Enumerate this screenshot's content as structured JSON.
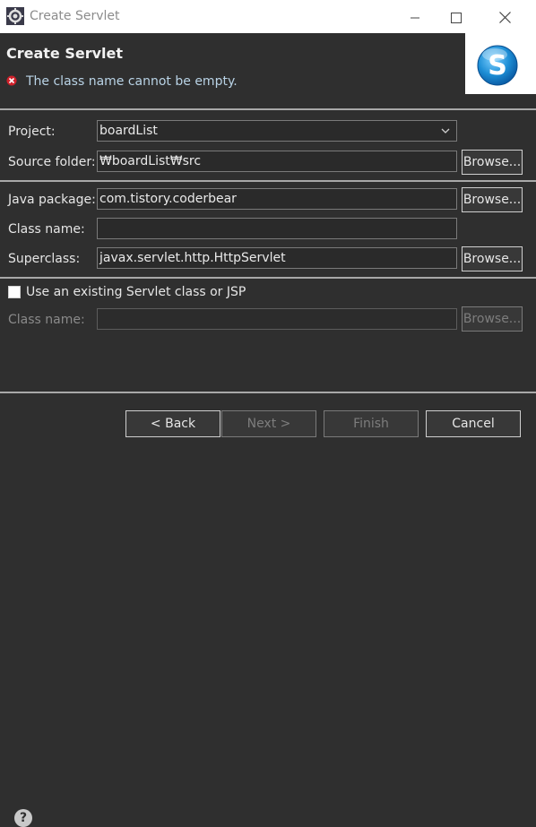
{
  "window": {
    "title": "Create Servlet",
    "app_icon": "eclipse-icon",
    "minimize_icon": "minimize-icon",
    "maximize_icon": "maximize-icon",
    "close_icon": "close-icon"
  },
  "header": {
    "title": "Create Servlet",
    "error_message": "The class name cannot be empty.",
    "error_icon": "error-icon",
    "banner_icon": "servlet-wizard-icon",
    "banner_letter": "S"
  },
  "form": {
    "project": {
      "label": "Project:",
      "value": "boardList"
    },
    "source_folder": {
      "label": "Source folder:",
      "value": "₩boardList₩src",
      "browse": "Browse..."
    },
    "java_package": {
      "label": "Java package:",
      "value": "com.tistory.coderbear",
      "browse": "Browse..."
    },
    "class_name": {
      "label": "Class name:",
      "value": ""
    },
    "superclass": {
      "label": "Superclass:",
      "value": "javax.servlet.http.HttpServlet",
      "browse": "Browse..."
    },
    "use_existing": {
      "label": "Use an existing Servlet class or JSP",
      "checked": false
    },
    "existing_class_name": {
      "label": "Class name:",
      "value": "",
      "browse": "Browse..."
    }
  },
  "footer": {
    "help_icon": "help-icon",
    "back": "< Back",
    "next": "Next >",
    "finish": "Finish",
    "cancel": "Cancel"
  },
  "colors": {
    "background": "#2f2f2f",
    "error_text": "#b9d3e6",
    "error_icon": "#d0202a",
    "banner_blue": "#1e8fd6"
  }
}
